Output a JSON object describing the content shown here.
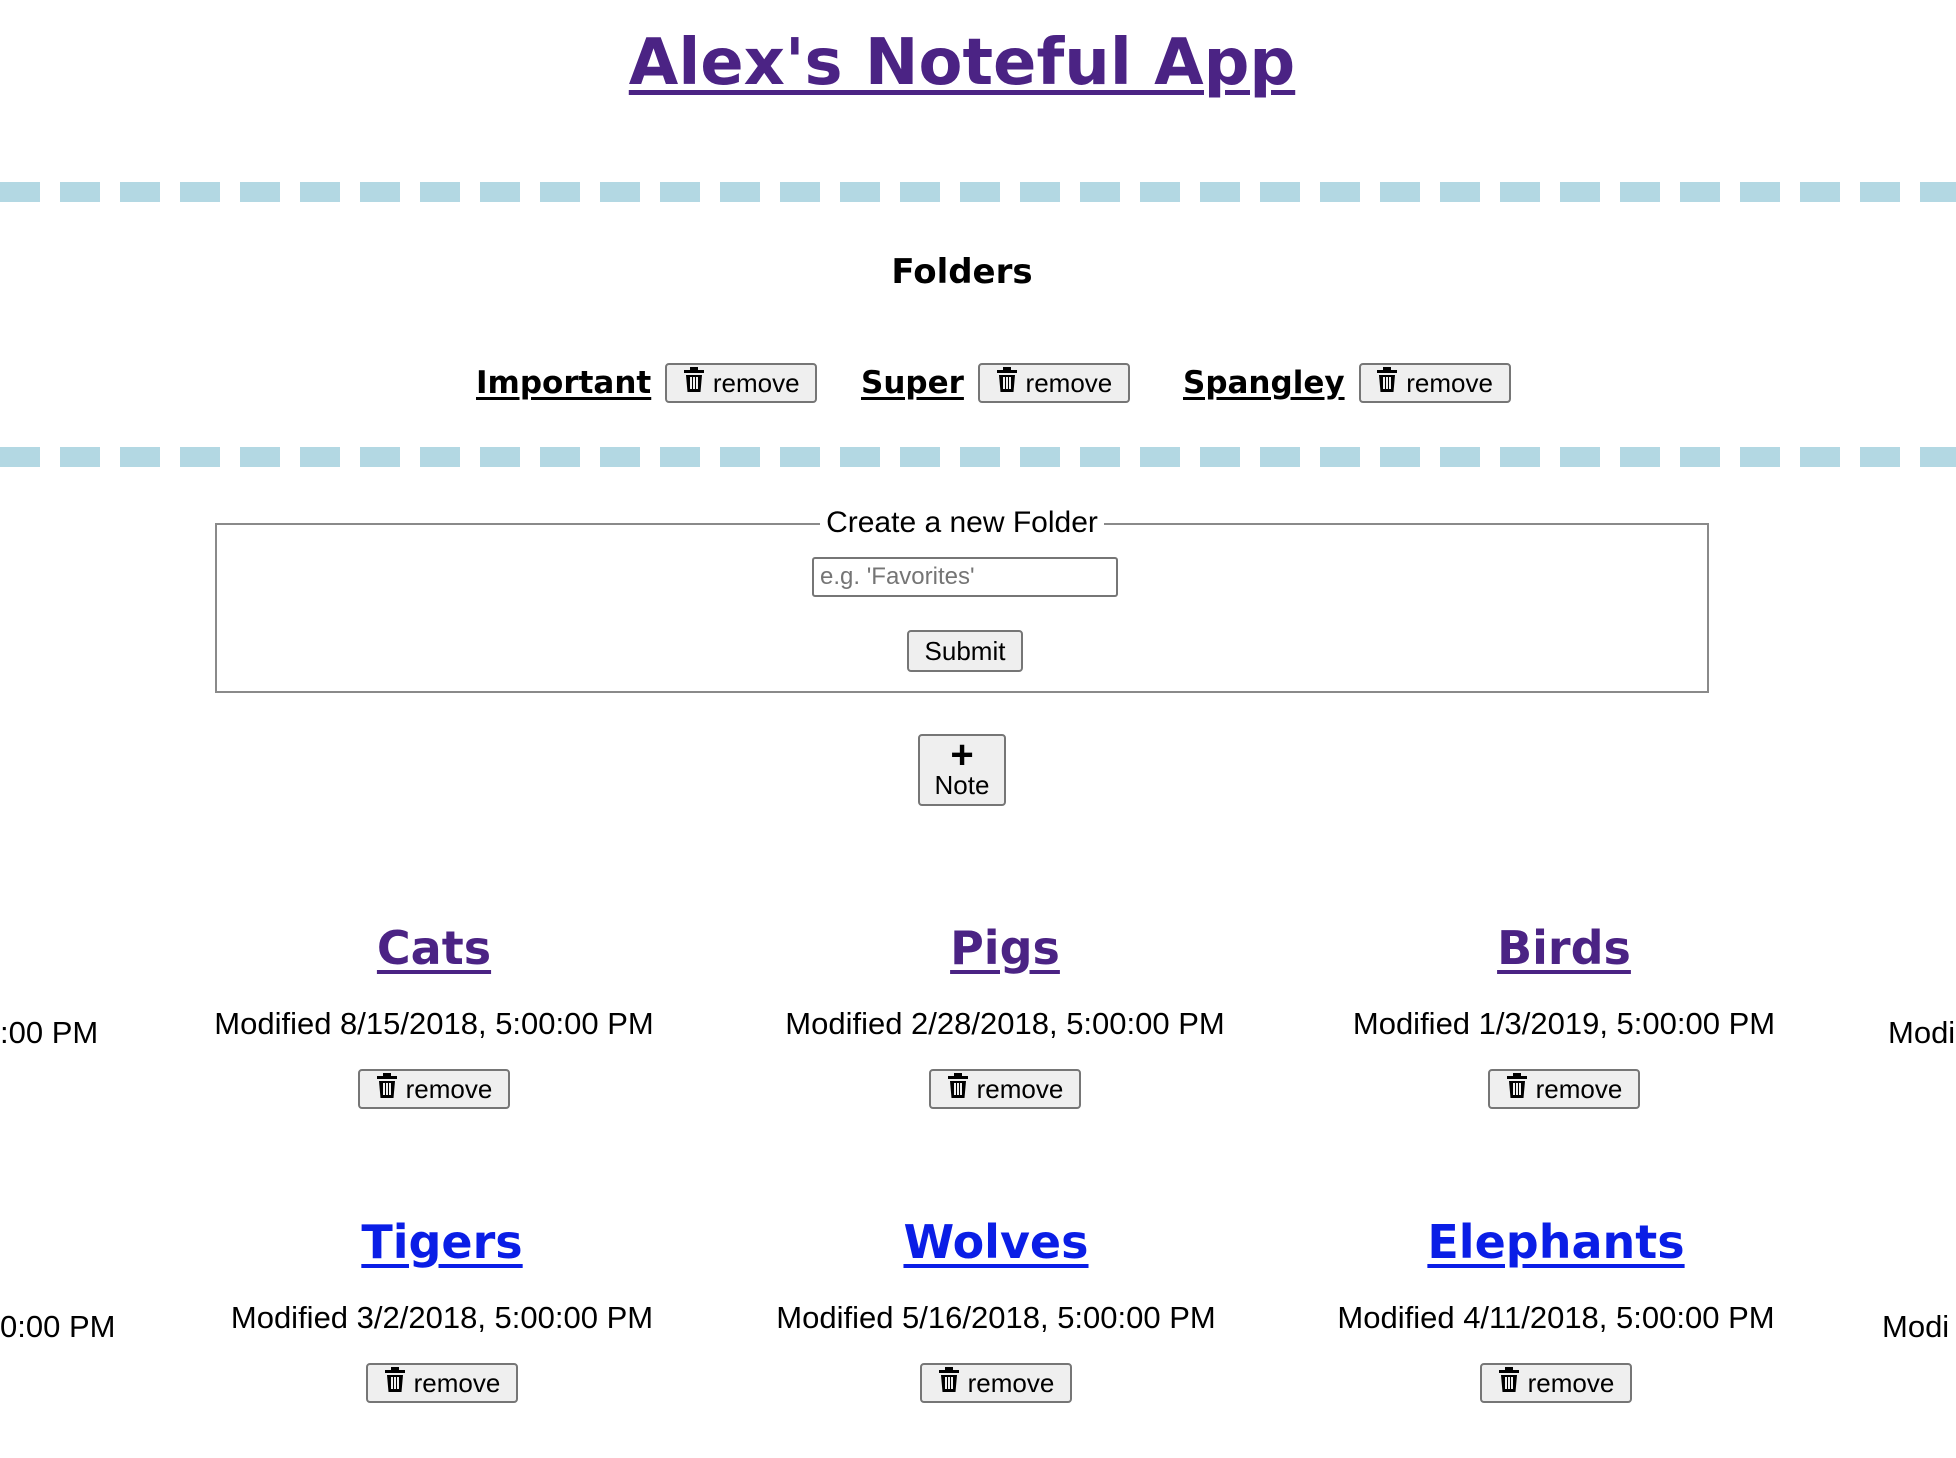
{
  "header": {
    "title": "Alex's Noteful App"
  },
  "folders": {
    "heading": "Folders",
    "remove_label": "remove",
    "items": [
      {
        "name": "Important"
      },
      {
        "name": "Super"
      },
      {
        "name": "Spangley"
      }
    ]
  },
  "new_folder_form": {
    "legend": "Create a new Folder",
    "placeholder": "e.g. 'Favorites'",
    "submit_label": "Submit"
  },
  "add_note": {
    "icon_glyph": "+",
    "label": "Note"
  },
  "notes": {
    "remove_label": "remove",
    "rows": [
      {
        "left_clip": ":00 PM",
        "right_clip": "Modi",
        "items": [
          {
            "title": "Cats",
            "modified": "Modified 8/15/2018, 5:00:00 PM"
          },
          {
            "title": "Pigs",
            "modified": "Modified 2/28/2018, 5:00:00 PM"
          },
          {
            "title": "Birds",
            "modified": "Modified 1/3/2019, 5:00:00 PM"
          }
        ]
      },
      {
        "left_clip": "0:00 PM",
        "right_clip": "Modi",
        "items": [
          {
            "title": "Tigers",
            "modified": "Modified 3/2/2018, 5:00:00 PM"
          },
          {
            "title": "Wolves",
            "modified": "Modified 5/16/2018, 5:00:00 PM"
          },
          {
            "title": "Elephants",
            "modified": "Modified 4/11/2018, 5:00:00 PM"
          }
        ]
      }
    ]
  },
  "colors": {
    "visited_link": "#4b2384",
    "unvisited_link": "#0a1ee6",
    "dash_line": "#b3d8e3"
  }
}
